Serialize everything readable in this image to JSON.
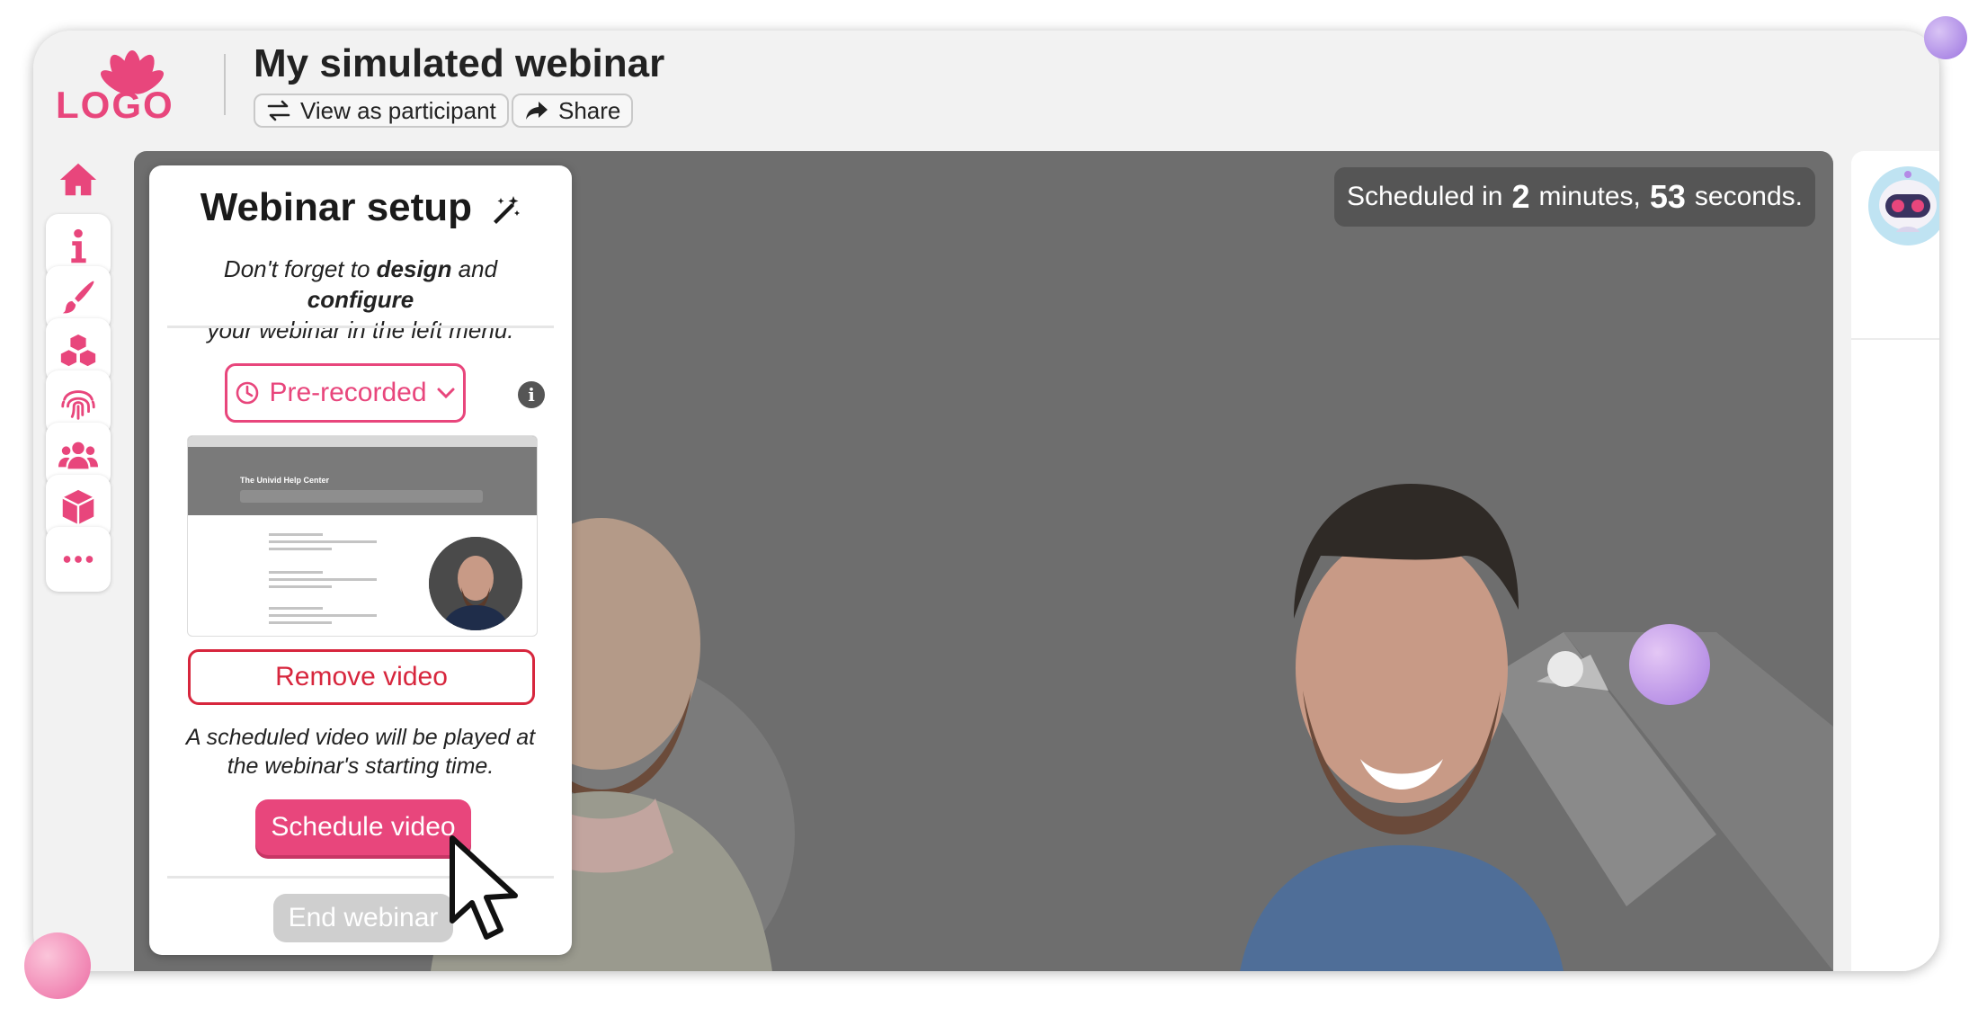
{
  "header": {
    "logo_text": "LOGO",
    "title": "My simulated webinar",
    "view_as_participant_label": "View as participant",
    "share_label": "Share"
  },
  "sidebar": {
    "items": [
      {
        "icon": "home-icon"
      },
      {
        "icon": "info-icon"
      },
      {
        "icon": "brush-icon"
      },
      {
        "icon": "cubes-icon"
      },
      {
        "icon": "fingerprint-icon"
      },
      {
        "icon": "users-icon"
      },
      {
        "icon": "box-icon"
      },
      {
        "icon": "more-icon"
      }
    ]
  },
  "stage": {
    "scheduled_prefix": "Scheduled in",
    "minutes_value": "2",
    "minutes_label": "minutes,",
    "seconds_value": "53",
    "seconds_label": "seconds."
  },
  "setup": {
    "title": "Webinar setup",
    "desc_line1_a": "Don't forget to ",
    "desc_line1_b": "design",
    "desc_line1_c": " and ",
    "desc_line1_d": "configure",
    "desc_line2": "your webinar in the left menu.",
    "mode_value": "Pre-recorded",
    "thumb_heading": "The Univid Help Center",
    "remove_video_label": "Remove video",
    "note": "A scheduled video will be played at the webinar's starting time.",
    "schedule_video_label": "Schedule video",
    "end_webinar_label": "End webinar"
  },
  "colors": {
    "accent": "#e8467c",
    "danger": "#d7263d",
    "stage_bg": "#6e6e6e"
  }
}
